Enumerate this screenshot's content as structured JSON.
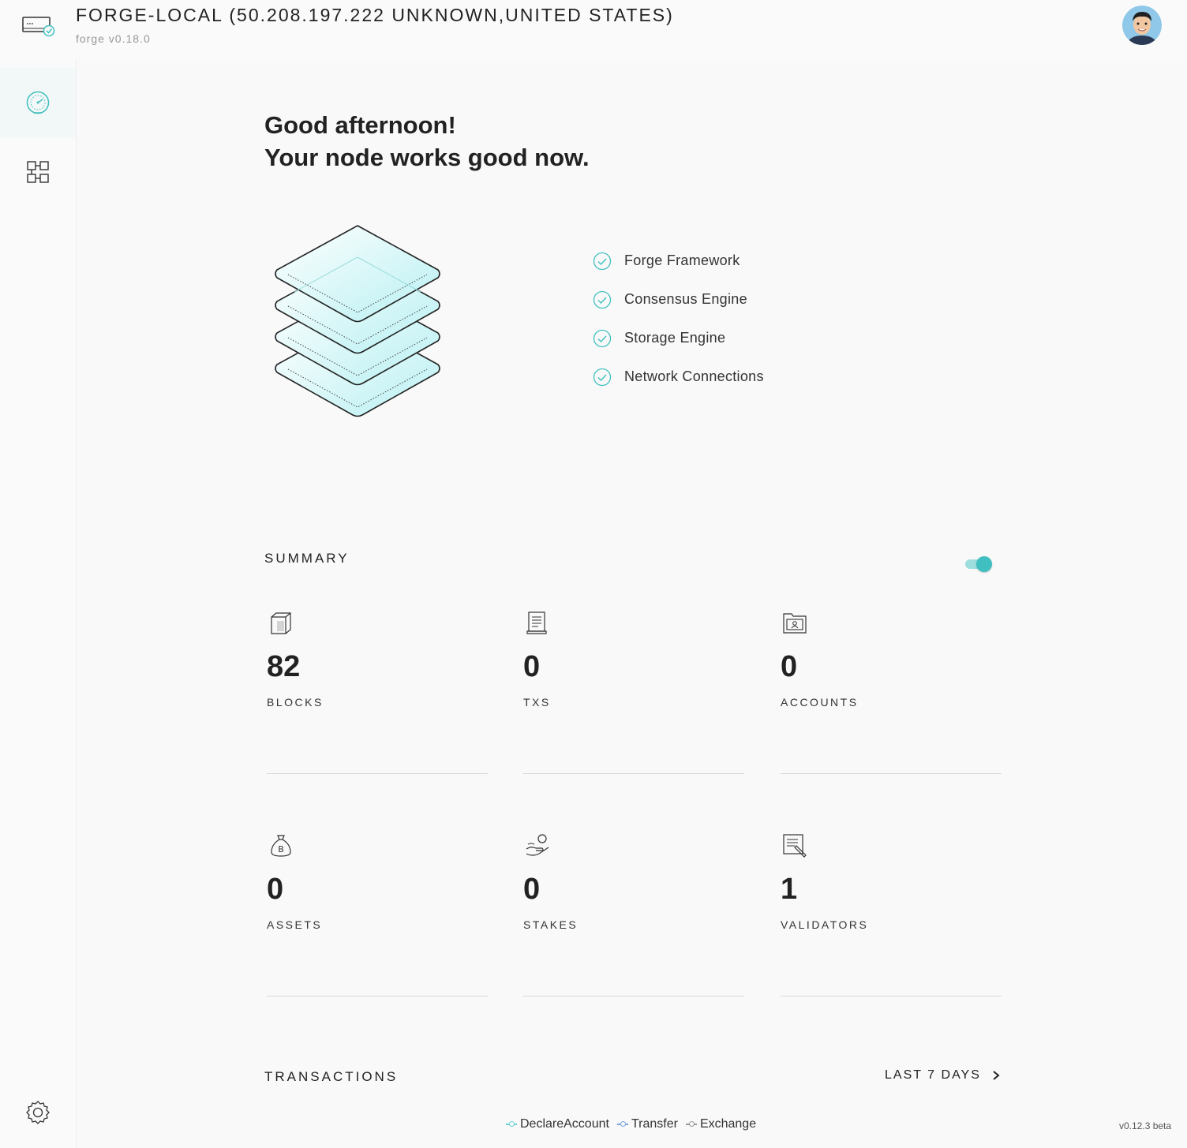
{
  "header": {
    "title": "FORGE-LOCAL (50.208.197.222 UNKNOWN,UNITED STATES)",
    "subtitle": "forge v0.18.0"
  },
  "sidebar": {
    "items": [
      {
        "name": "dashboard",
        "icon": "speedometer-icon",
        "active": true
      },
      {
        "name": "blocks",
        "icon": "blocks-icon",
        "active": false
      }
    ],
    "settings_icon": "gear-icon"
  },
  "greeting": {
    "line1": "Good afternoon!",
    "line2": "Your node works good now."
  },
  "status_items": [
    {
      "label": "Forge Framework",
      "icon": "check-circle-icon"
    },
    {
      "label": "Consensus Engine",
      "icon": "check-circle-icon"
    },
    {
      "label": "Storage Engine",
      "icon": "check-circle-icon"
    },
    {
      "label": "Network Connections",
      "icon": "check-circle-icon"
    }
  ],
  "summary": {
    "title": "SUMMARY",
    "toggle_on": true,
    "stats": [
      {
        "value": "82",
        "label": "BLOCKS",
        "icon": "cube-icon"
      },
      {
        "value": "0",
        "label": "TXS",
        "icon": "receipt-icon"
      },
      {
        "value": "0",
        "label": "ACCOUNTS",
        "icon": "account-folder-icon"
      },
      {
        "value": "0",
        "label": "ASSETS",
        "icon": "money-bag-icon"
      },
      {
        "value": "0",
        "label": "STAKES",
        "icon": "hand-coin-icon"
      },
      {
        "value": "1",
        "label": "VALIDATORS",
        "icon": "document-pen-icon"
      }
    ]
  },
  "transactions": {
    "title": "TRANSACTIONS",
    "range_label": "LAST 7 DAYS",
    "legend": [
      {
        "label": "DeclareAccount",
        "color": "#6fd3d3"
      },
      {
        "label": "Transfer",
        "color": "#7aa7e0"
      },
      {
        "label": "Exchange",
        "color": "#999999"
      }
    ]
  },
  "footer": {
    "version": "v0.12.3 beta"
  },
  "colors": {
    "accent": "#3fbfbf"
  }
}
